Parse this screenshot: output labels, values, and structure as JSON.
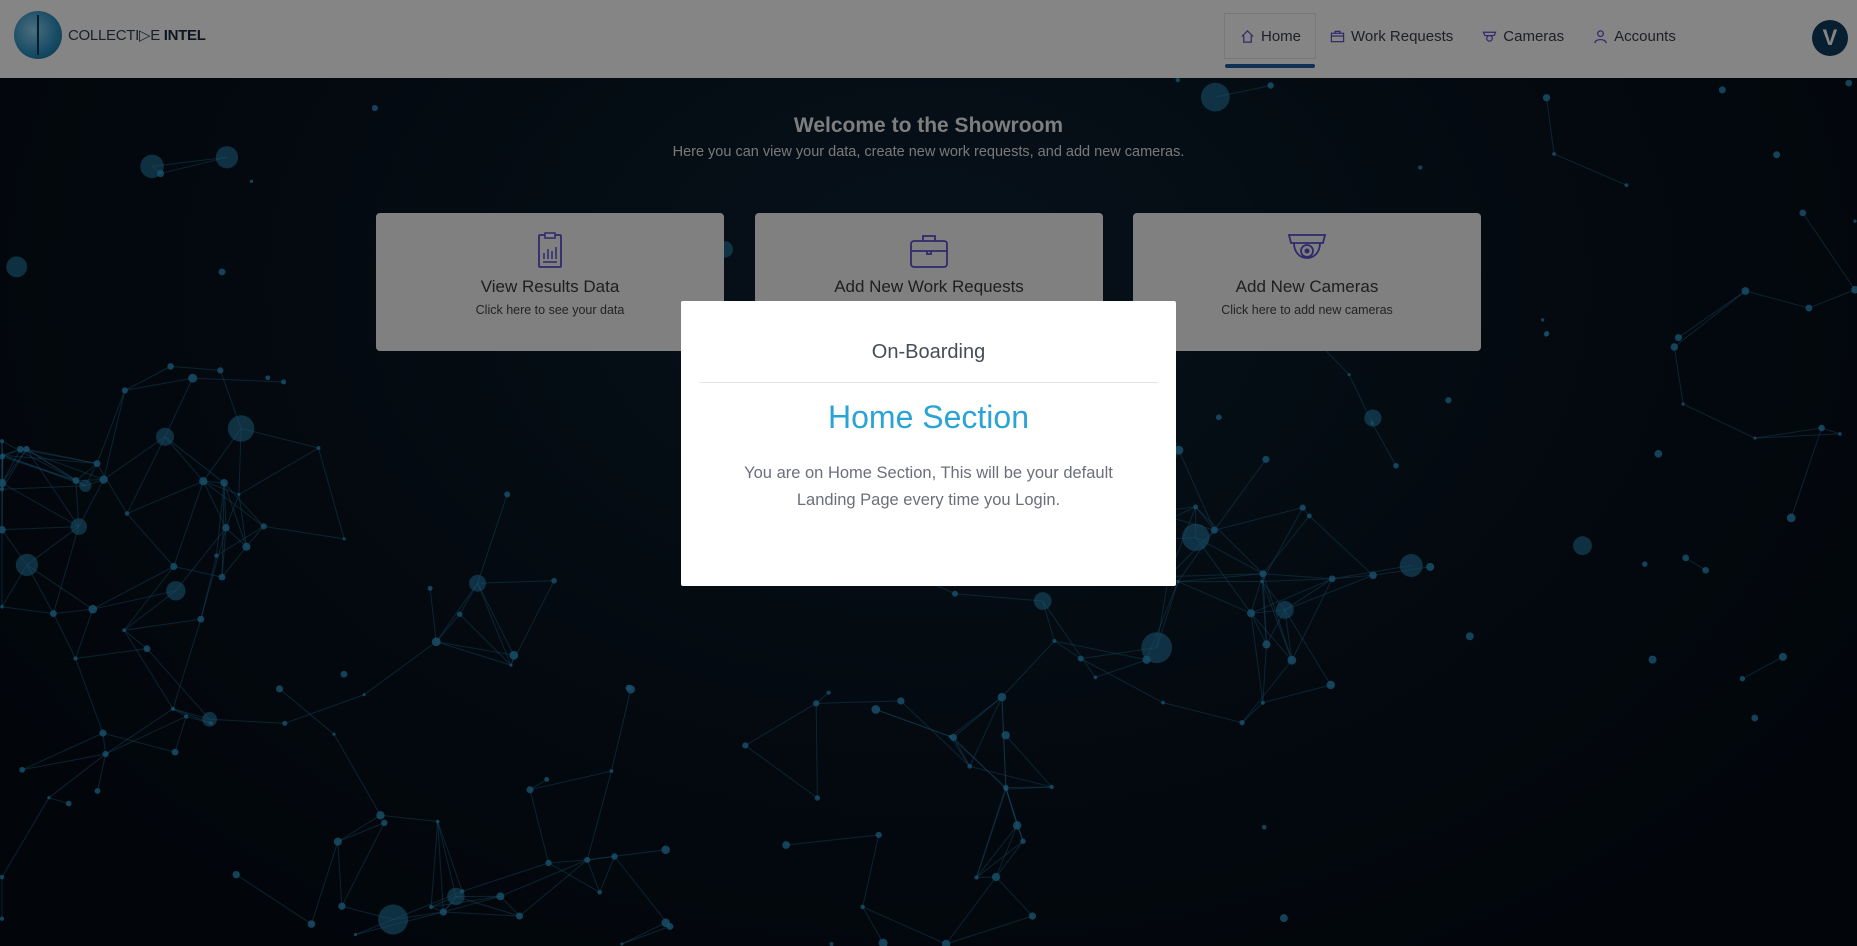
{
  "brand": {
    "logo_text_light": "COLLECTI▷E",
    "logo_text_bold": "INTEL"
  },
  "nav": {
    "items": [
      {
        "label": "Home",
        "icon": "home-icon",
        "active": true
      },
      {
        "label": "Work Requests",
        "icon": "briefcase-icon",
        "active": false
      },
      {
        "label": "Cameras",
        "icon": "camera-icon",
        "active": false
      },
      {
        "label": "Accounts",
        "icon": "user-icon",
        "active": false
      }
    ],
    "avatar_letter": "V"
  },
  "welcome": {
    "title": "Welcome to the Showroom",
    "subtitle": "Here you can view your data, create new work requests, and add new cameras."
  },
  "cards": [
    {
      "title": "View Results Data",
      "subtitle": "Click here to see your data",
      "icon": "clipboard-chart-icon"
    },
    {
      "title": "Add New Work Requests",
      "subtitle": "",
      "icon": "briefcase-icon"
    },
    {
      "title": "Add New Cameras",
      "subtitle": "Click here to add new cameras",
      "icon": "security-camera-icon"
    }
  ],
  "modal": {
    "header": "On-Boarding",
    "title": "Home Section",
    "text": "You are on Home Section, This will be your default Landing Page every time you Login."
  },
  "colors": {
    "accent": "#2aa4d5",
    "nav_active_underline": "#1f5fa0",
    "icon_purple": "#5a4fcf",
    "background": "#07121d"
  }
}
